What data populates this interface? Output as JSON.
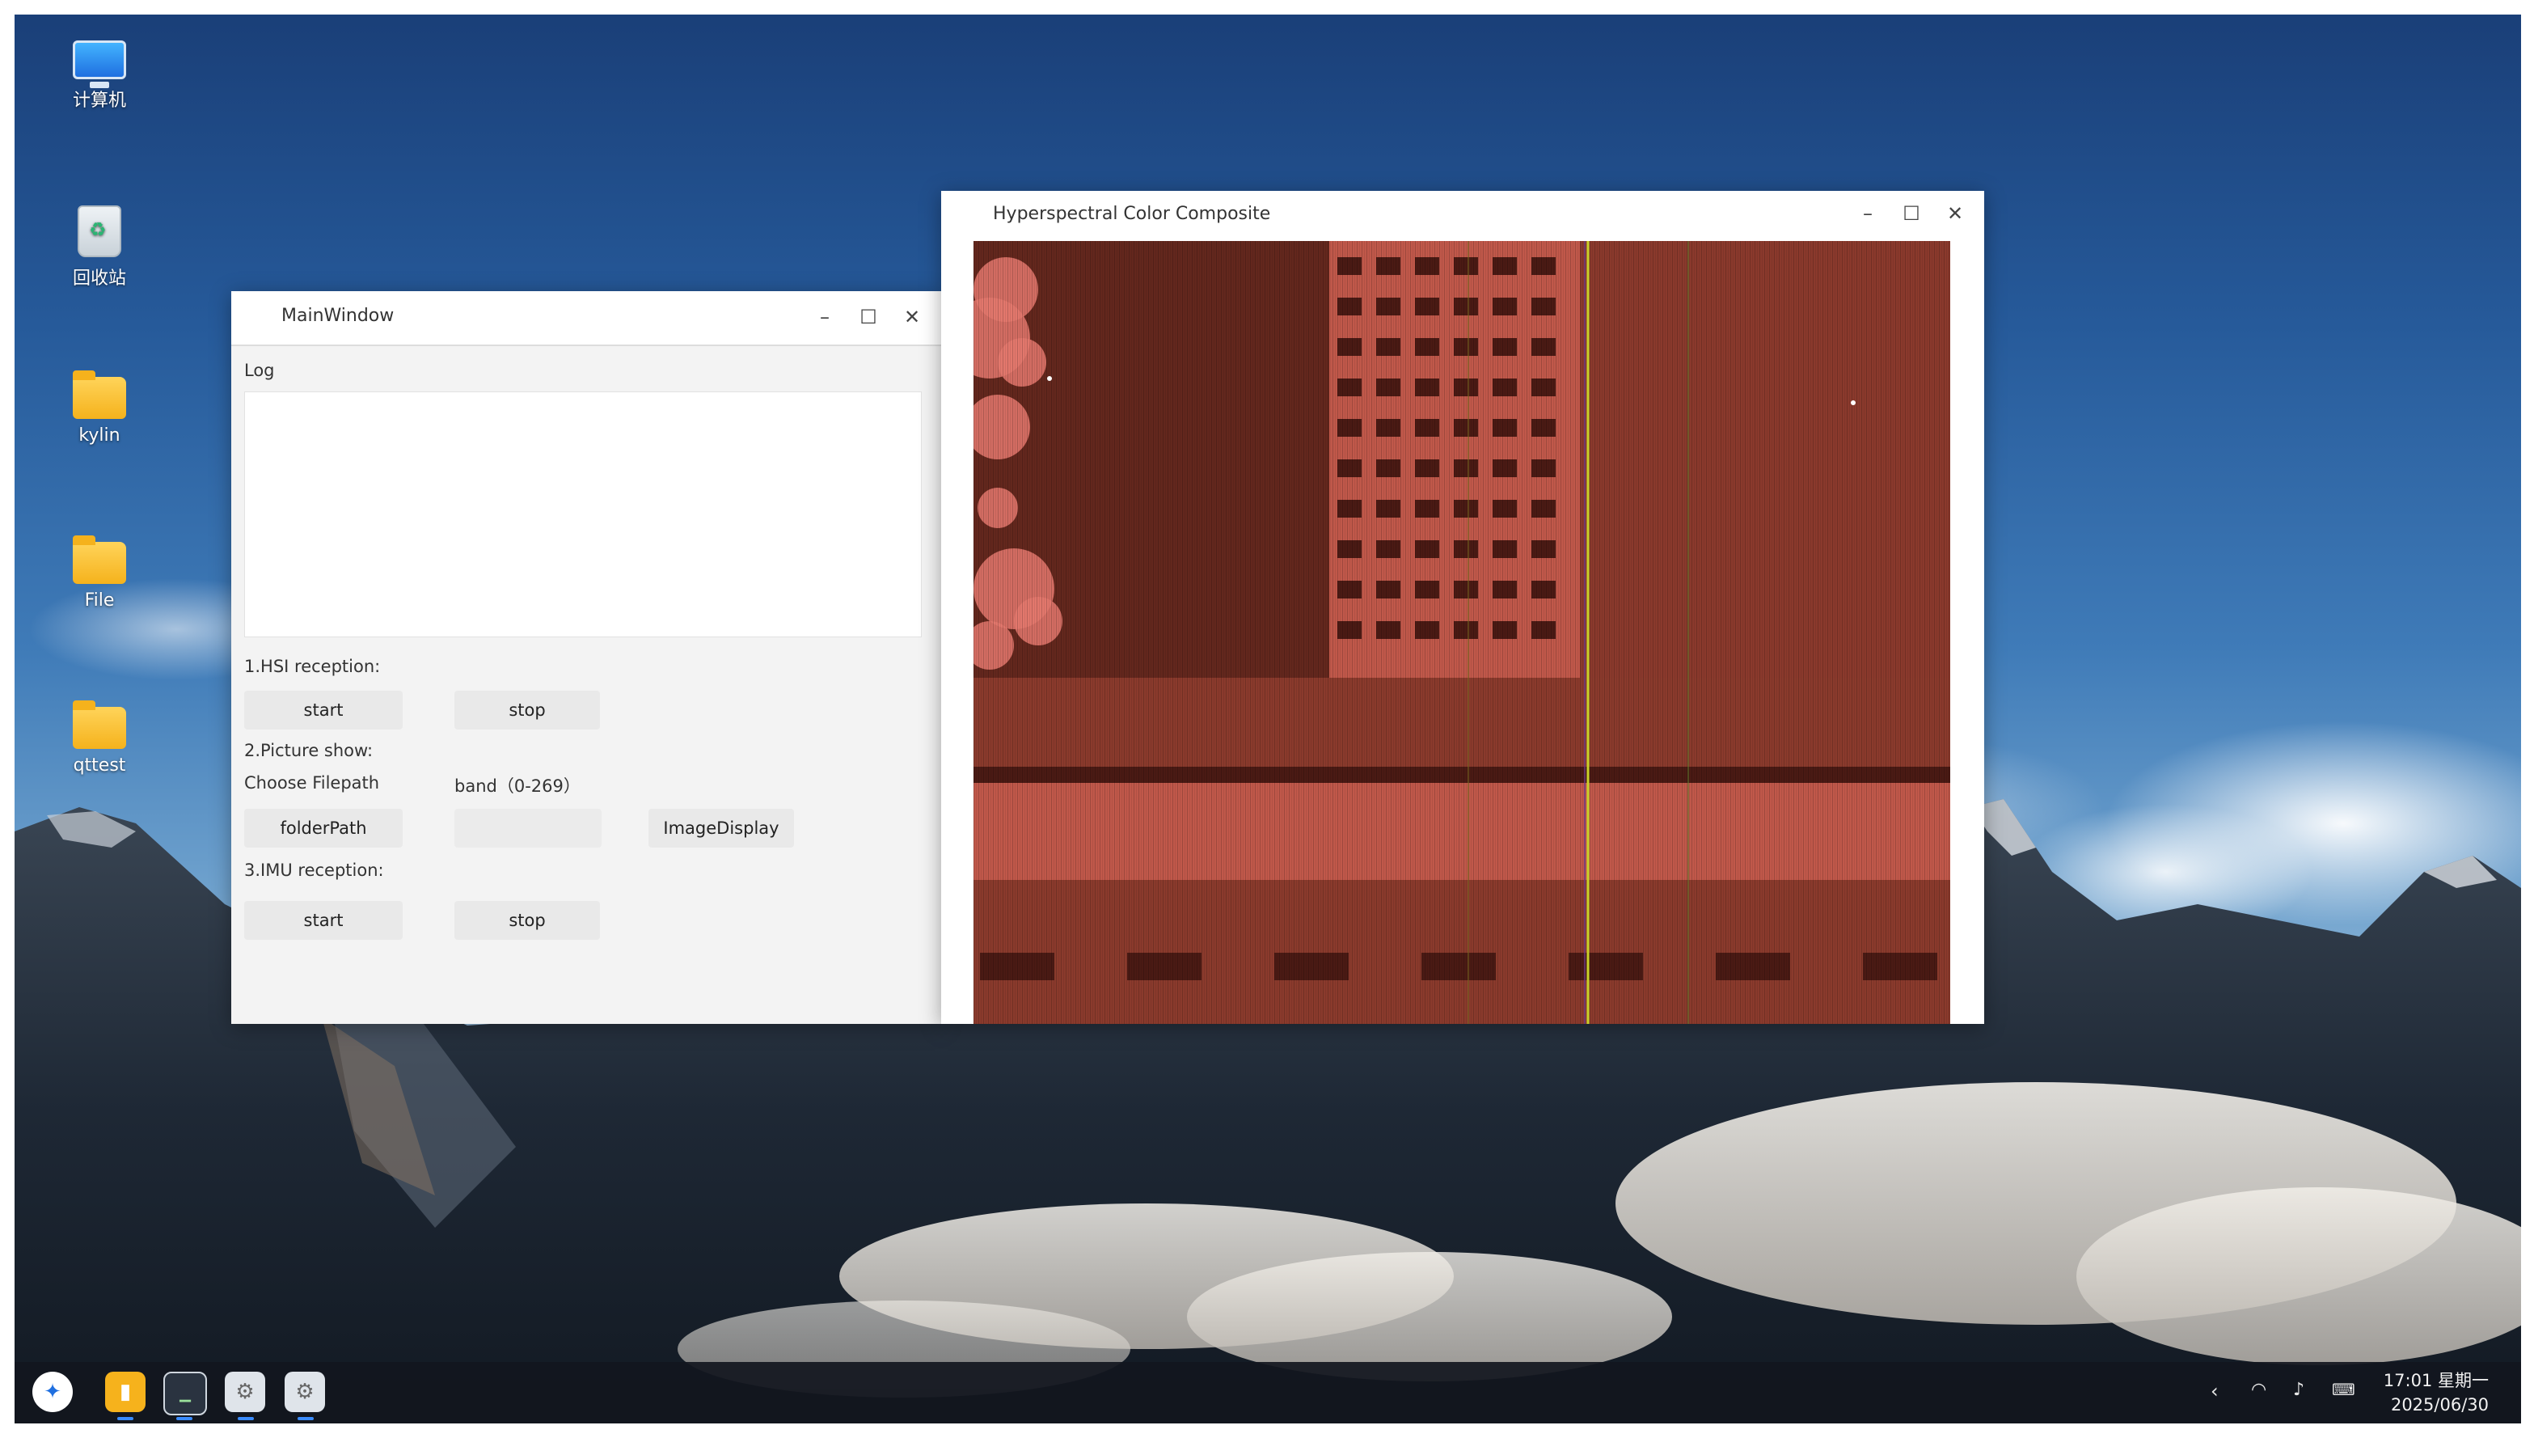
{
  "desktop": {
    "icons": [
      {
        "label": "计算机",
        "icon": "computer-icon"
      },
      {
        "label": "回收站",
        "icon": "trash-icon"
      },
      {
        "label": "kylin",
        "icon": "folder-icon"
      },
      {
        "label": "File",
        "icon": "folder-icon"
      },
      {
        "label": "qttest",
        "icon": "folder-icon"
      }
    ]
  },
  "main_window": {
    "title": "MainWindow",
    "log_label": "Log",
    "log_text": "",
    "hsi_section": "1.HSI reception:",
    "hsi_start": "start",
    "hsi_stop": "stop",
    "picture_section": "2.Picture show:",
    "choose_filepath_label": "Choose Filepath",
    "band_label": "band（0-269）",
    "folder_button": "folderPath",
    "band_value": "",
    "image_display_button": "ImageDisplay",
    "imu_section": "3.IMU reception:",
    "imu_start": "start",
    "imu_stop": "stop"
  },
  "image_window": {
    "title": "Hyperspectral Color Composite",
    "image": "hyperspectral false-color composite of building rooftop (red tones)"
  },
  "window_controls": {
    "minimize": "–",
    "maximize": "☐",
    "close": "✕"
  },
  "taskbar": {
    "apps": [
      "start-menu-icon",
      "file-manager-icon",
      "terminal-icon",
      "settings-icon",
      "settings-icon"
    ],
    "time": "17:01 星期一",
    "date": "2025/06/30"
  },
  "colors": {
    "hsi_base": "#8a3a2c",
    "hsi_dark": "#4a1a14",
    "hsi_light": "#c0584a",
    "hsi_foliage": "#e5796f",
    "accent": "#3a8cff"
  }
}
